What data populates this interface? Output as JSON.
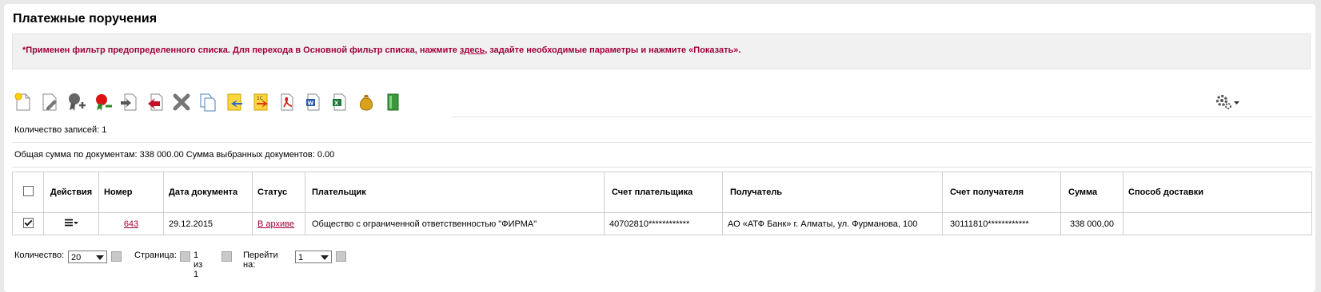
{
  "header": {
    "title": "Платежные поручения"
  },
  "filter_notice": {
    "before": "*Применен фильтр предопределенного списка. Для перехода в Основной фильтр списка, нажмите ",
    "link": "здесь",
    "after": ", задайте необходимые параметры и нажмите «Показать»."
  },
  "toolbar": {
    "icons": [
      "new-document-icon",
      "edit-document-icon",
      "sign-icon",
      "unsign-icon",
      "send-icon",
      "recall-icon",
      "delete-icon",
      "copy-icon",
      "import-icon",
      "export-icon",
      "pdf-icon",
      "word-icon",
      "excel-icon",
      "money-bag-icon",
      "archive-icon"
    ]
  },
  "summary": {
    "records": "Количество записей: 1",
    "totals": "Общая сумма по документам: 338 000.00 Сумма выбранных документов: 0.00"
  },
  "table": {
    "headers": {
      "actions": "Действия",
      "number": "Номер",
      "date": "Дата документа",
      "status": "Статус",
      "payer": "Плательщик",
      "payer_account": "Счет плательщика",
      "recipient": "Получатель",
      "recipient_account": "Счет получателя",
      "amount": "Сумма",
      "delivery": "Способ доставки"
    },
    "rows": [
      {
        "checked": true,
        "number": "643",
        "date": "29.12.2015",
        "status": "В архиве",
        "payer": "Общество с ограниченной ответственностью \"ФИРМА\"",
        "payer_account": "40702810************",
        "recipient": "АО «АТФ Банк» г. Алматы, ул. Фурманова, 100",
        "recipient_account": "30111810************",
        "amount": "338 000,00",
        "delivery": ""
      }
    ]
  },
  "pager": {
    "count_label": "Количество:",
    "count_value": "20",
    "page_label": "Страница:",
    "page_info": "1 из 1",
    "goto_label": "Перейти на:",
    "goto_value": "1"
  },
  "colors": {
    "accent": "#a0003a",
    "filter_bg": "#f1f1f1"
  }
}
